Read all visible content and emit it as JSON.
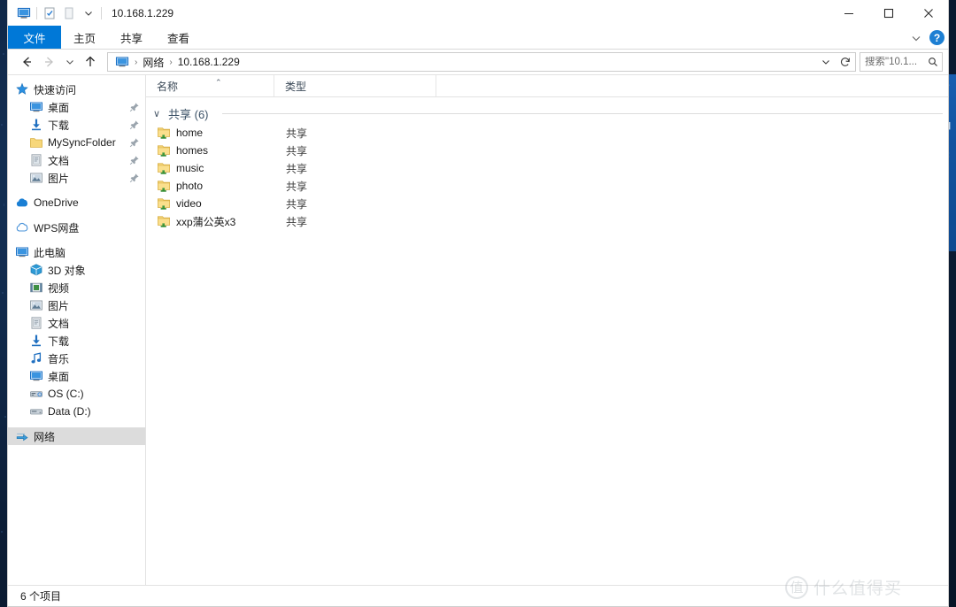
{
  "window": {
    "title": "10.168.1.229",
    "quick_access_toolbar": [
      {
        "name": "this-pc-icon",
        "label": "此电脑"
      },
      {
        "name": "properties-icon",
        "label": "属性"
      },
      {
        "name": "new-folder-icon",
        "label": "新建文件夹"
      },
      {
        "name": "customize-dropdown-icon",
        "label": "自定义快速访问工具栏"
      }
    ],
    "controls": {
      "minimize": "—",
      "maximize": "☐",
      "close": "✕"
    }
  },
  "ribbon": {
    "tabs": [
      {
        "label": "文件",
        "active": true
      },
      {
        "label": "主页",
        "active": false
      },
      {
        "label": "共享",
        "active": false
      },
      {
        "label": "查看",
        "active": false
      }
    ],
    "collapse_icon": "chevron-down-icon",
    "help_label": "?"
  },
  "navigation": {
    "back_label": "返回",
    "forward_label": "前进",
    "recent_label": "最近浏览的位置",
    "up_label": "上移一级",
    "breadcrumb": [
      "网络",
      "10.168.1.229"
    ],
    "breadcrumb_separator": "›",
    "dropdown_label": "以前的位置",
    "refresh_label": "刷新"
  },
  "search": {
    "placeholder": "搜索\"10.1...",
    "value": ""
  },
  "sidebar": {
    "items": [
      {
        "label": "快速访问",
        "icon": "star-pin-icon",
        "level": 0,
        "pinned": false,
        "selected": false
      },
      {
        "label": "桌面",
        "icon": "desktop-icon",
        "level": 1,
        "pinned": true,
        "selected": false
      },
      {
        "label": "下载",
        "icon": "download-icon",
        "level": 1,
        "pinned": true,
        "selected": false
      },
      {
        "label": "MySyncFolder",
        "icon": "folder-icon",
        "level": 1,
        "pinned": true,
        "selected": false
      },
      {
        "label": "文档",
        "icon": "documents-icon",
        "level": 1,
        "pinned": true,
        "selected": false
      },
      {
        "label": "图片",
        "icon": "pictures-icon",
        "level": 1,
        "pinned": true,
        "selected": false
      },
      {
        "label": "OneDrive",
        "icon": "onedrive-cloud-icon",
        "level": 0,
        "pinned": false,
        "selected": false,
        "gap_before": true
      },
      {
        "label": "WPS网盘",
        "icon": "wps-cloud-icon",
        "level": 0,
        "pinned": false,
        "selected": false,
        "gap_before": true
      },
      {
        "label": "此电脑",
        "icon": "this-pc-icon",
        "level": 0,
        "pinned": false,
        "selected": false,
        "gap_before": true
      },
      {
        "label": "3D 对象",
        "icon": "3d-objects-icon",
        "level": 1,
        "pinned": false,
        "selected": false
      },
      {
        "label": "视频",
        "icon": "videos-icon",
        "level": 1,
        "pinned": false,
        "selected": false
      },
      {
        "label": "图片",
        "icon": "pictures-icon",
        "level": 1,
        "pinned": false,
        "selected": false
      },
      {
        "label": "文档",
        "icon": "documents-icon",
        "level": 1,
        "pinned": false,
        "selected": false
      },
      {
        "label": "下载",
        "icon": "download-icon",
        "level": 1,
        "pinned": false,
        "selected": false
      },
      {
        "label": "音乐",
        "icon": "music-icon",
        "level": 1,
        "pinned": false,
        "selected": false
      },
      {
        "label": "桌面",
        "icon": "desktop-icon",
        "level": 1,
        "pinned": false,
        "selected": false
      },
      {
        "label": "OS (C:)",
        "icon": "os-drive-icon",
        "level": 1,
        "pinned": false,
        "selected": false
      },
      {
        "label": "Data (D:)",
        "icon": "drive-icon",
        "level": 1,
        "pinned": false,
        "selected": false
      },
      {
        "label": "网络",
        "icon": "network-icon",
        "level": 0,
        "pinned": false,
        "selected": true,
        "gap_before": true
      }
    ]
  },
  "columns": [
    {
      "label": "名称",
      "sorted": "asc",
      "sort_caret": "⌃"
    },
    {
      "label": "类型",
      "sorted": "",
      "sort_caret": ""
    }
  ],
  "file_list": {
    "group": {
      "label": "共享 (6)",
      "chevron": "∨"
    },
    "rows": [
      {
        "name": "home",
        "type": "共享",
        "icon": "shared-folder-icon"
      },
      {
        "name": "homes",
        "type": "共享",
        "icon": "shared-folder-icon"
      },
      {
        "name": "music",
        "type": "共享",
        "icon": "shared-folder-icon"
      },
      {
        "name": "photo",
        "type": "共享",
        "icon": "shared-folder-icon"
      },
      {
        "name": "video",
        "type": "共享",
        "icon": "shared-folder-icon"
      },
      {
        "name": "xxp蒲公英x3",
        "type": "共享",
        "icon": "shared-folder-icon"
      }
    ]
  },
  "status": {
    "item_count_label": "6 个项目"
  },
  "watermark": {
    "mark": "值",
    "text": "什么值得买"
  },
  "colors": {
    "accent": "#0078d7",
    "file_tab": "#0078d7",
    "selection": "#dcdcdc",
    "hover": "#e5f3fb",
    "folder": "#f5c544",
    "share_badge": "#3a9e3a",
    "group_title": "#3b5166"
  }
}
